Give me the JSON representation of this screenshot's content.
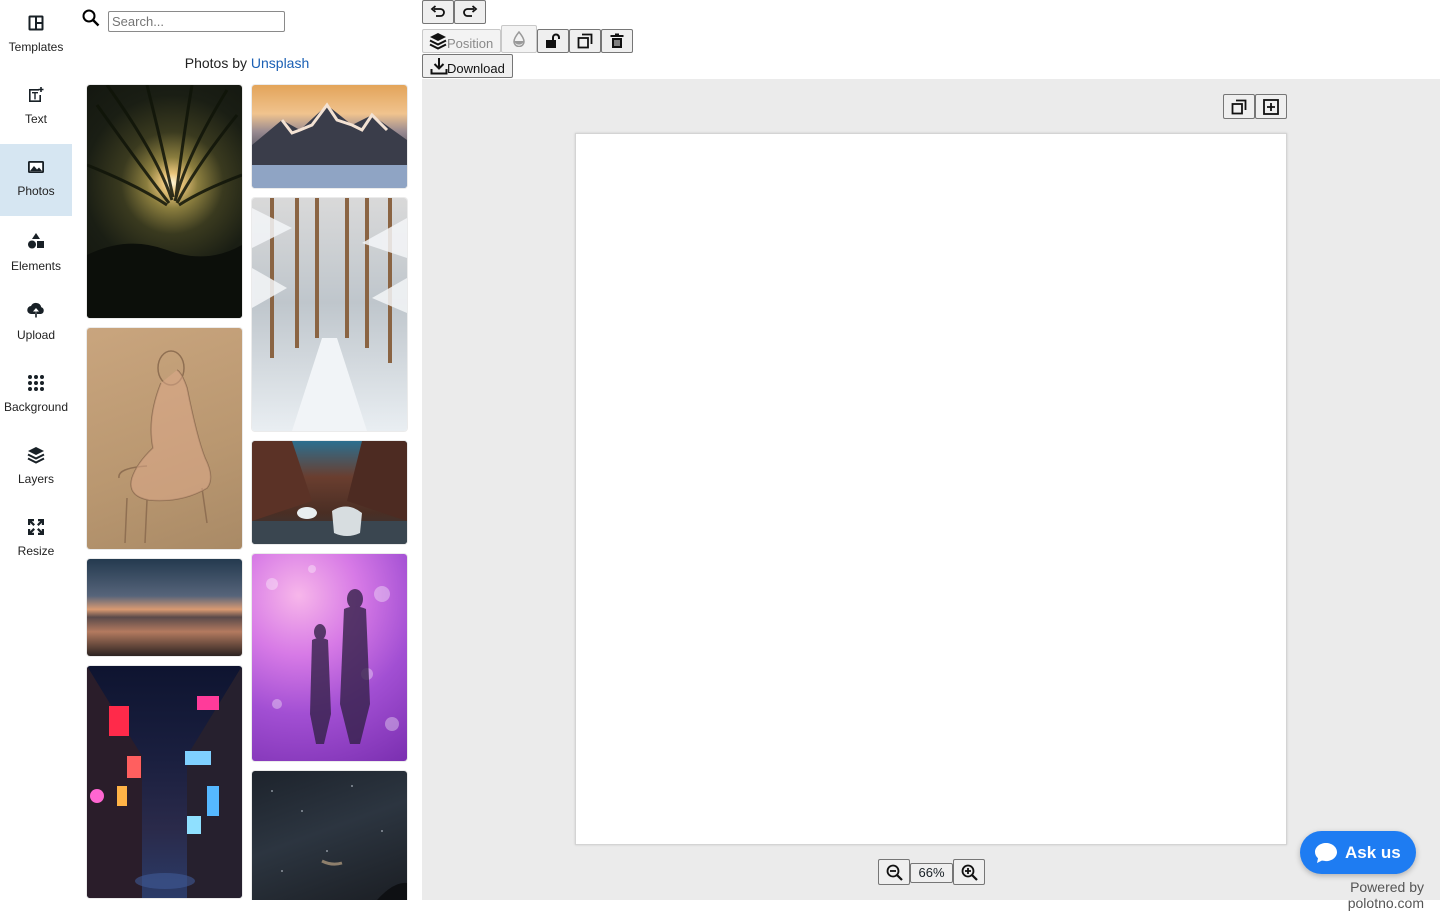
{
  "sidebar": {
    "items": [
      {
        "label": "Templates",
        "icon": "templates-icon"
      },
      {
        "label": "Text",
        "icon": "text-icon"
      },
      {
        "label": "Photos",
        "icon": "photos-icon",
        "active": true
      },
      {
        "label": "Elements",
        "icon": "elements-icon"
      },
      {
        "label": "Upload",
        "icon": "upload-icon"
      },
      {
        "label": "Background",
        "icon": "background-icon"
      },
      {
        "label": "Layers",
        "icon": "layers-icon"
      },
      {
        "label": "Resize",
        "icon": "resize-icon"
      }
    ]
  },
  "photos_panel": {
    "search_placeholder": "Search...",
    "credit_prefix": "Photos by ",
    "credit_link": "Unsplash"
  },
  "toolbar": {
    "position_label": "Position",
    "download_label": "Download"
  },
  "zoom": {
    "value": "66%"
  },
  "chat": {
    "ask_label": "Ask us"
  },
  "footer": {
    "powered_by": "Powered by polotno.com"
  },
  "colors": {
    "accent": "#1e7cf2",
    "active_tab": "#d6e6f2",
    "workspace_bg": "#ebebeb"
  }
}
